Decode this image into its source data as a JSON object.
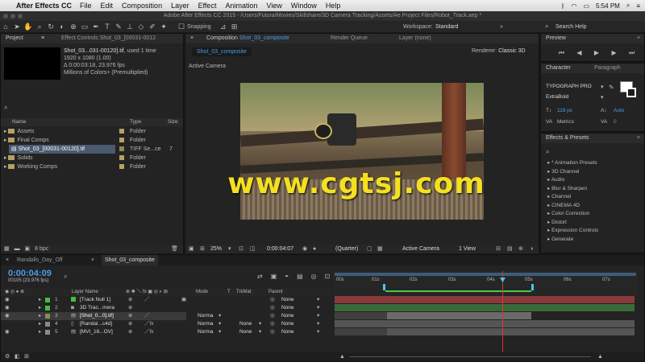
{
  "menubar": {
    "apple_icon": "apple-icon",
    "app": "After Effects CC",
    "items": [
      "File",
      "Edit",
      "Composition",
      "Layer",
      "Effect",
      "Animation",
      "View",
      "Window",
      "Help"
    ],
    "clock": "5:54 PM"
  },
  "titlebar": {
    "text": "Adobe After Effects CC 2015 - /Users/Futura/Movies/Skillshare/3D Camera Tracking/Assets/Ae Project Files/Robot_Track.aep *"
  },
  "toolbar": {
    "snapping": "Snapping",
    "workspace_label": "Workspace:",
    "workspace": "Standard",
    "search_placeholder": "Search Help"
  },
  "project": {
    "tab": "Project",
    "effect_controls_tab": "Effect Controls Shot_03_[00031-0012",
    "thumb_name": "Shot_03...031-00120].tif",
    "used": ", used 1 time",
    "dims": "1920 x 1080 (1.00)",
    "duration": "Δ 0:00:03:18, 23.976 fps",
    "colors": "Millions of Colors+ (Premultiplied)",
    "columns": {
      "name": "Name",
      "type": "Type",
      "size": "Size"
    },
    "items": [
      {
        "name": "Assets",
        "type": "Folder",
        "size": ""
      },
      {
        "name": "Final Comps",
        "type": "Folder",
        "size": ""
      },
      {
        "name": "Shot_03_[00031-00120].tif",
        "type": "TIFF Se...ce",
        "size": "7"
      },
      {
        "name": "Solids",
        "type": "Folder",
        "size": ""
      },
      {
        "name": "Working Comps",
        "type": "Folder",
        "size": ""
      }
    ],
    "bpc": "8 bpc"
  },
  "composition": {
    "tab_prefix": "Composition",
    "tab_name": "Shot_03_composite",
    "render_queue": "Render Queue",
    "layer_tab": "Layer (none)",
    "subtab": "Shot_03_composite",
    "renderer_label": "Renderer:",
    "renderer": "Classic 3D",
    "active_camera": "Active Camera",
    "watermark": "www.cgtsj.com",
    "zoom": "25%",
    "timecode": "0:00:04:07",
    "resolution": "(Quarter)",
    "view": "Active Camera",
    "views": "1 View"
  },
  "preview": {
    "title": "Preview"
  },
  "character": {
    "tab": "Character",
    "paragraph_tab": "Paragraph",
    "font": "TYPOGRAPH PRO",
    "style": "ExtraBold",
    "size": "116 px",
    "leading": "Auto",
    "kerning": "Metrics",
    "tracking": "0"
  },
  "effects": {
    "title": "Effects & Presets",
    "items": [
      "* Animation Presets",
      "3D Channel",
      "Audio",
      "Blur & Sharpen",
      "Channel",
      "CINEMA 4D",
      "Color Correction",
      "Distort",
      "Expression Controls",
      "Generate"
    ]
  },
  "timeline": {
    "tabs": [
      "Randalls_Day_Off",
      "Shot_03_composite"
    ],
    "timecode": "0:00:04:09",
    "frames": "00105 (23.976 fps)",
    "columns": {
      "layer_name": "Layer Name",
      "mode": "Mode",
      "t": "T",
      "trkmat": "TrkMat",
      "parent": "Parent"
    },
    "ruler": [
      "00s",
      "01s",
      "02s",
      "03s",
      "04s",
      "05s",
      "06s",
      "07s"
    ],
    "layers": [
      {
        "num": "1",
        "name": "[Track Null 1]",
        "color": "#3fbf3f",
        "mode": "",
        "trkmat": "",
        "parent": "None"
      },
      {
        "num": "2",
        "name": "3D Trac...mera",
        "color": "#3fbf3f",
        "mode": "",
        "trkmat": "",
        "parent": "None"
      },
      {
        "num": "3",
        "name": "[Shot_0...0].tif]",
        "color": "#8a8a5a",
        "mode": "Norma",
        "trkmat": "",
        "parent": "None"
      },
      {
        "num": "4",
        "name": "[Randal...c4d]",
        "color": "#8a8a8a",
        "mode": "Norma",
        "trkmat": "None",
        "parent": "None"
      },
      {
        "num": "5",
        "name": "[MVI_16...OV]",
        "color": "#8a8a8a",
        "mode": "Norma",
        "trkmat": "None",
        "parent": "None"
      }
    ]
  }
}
